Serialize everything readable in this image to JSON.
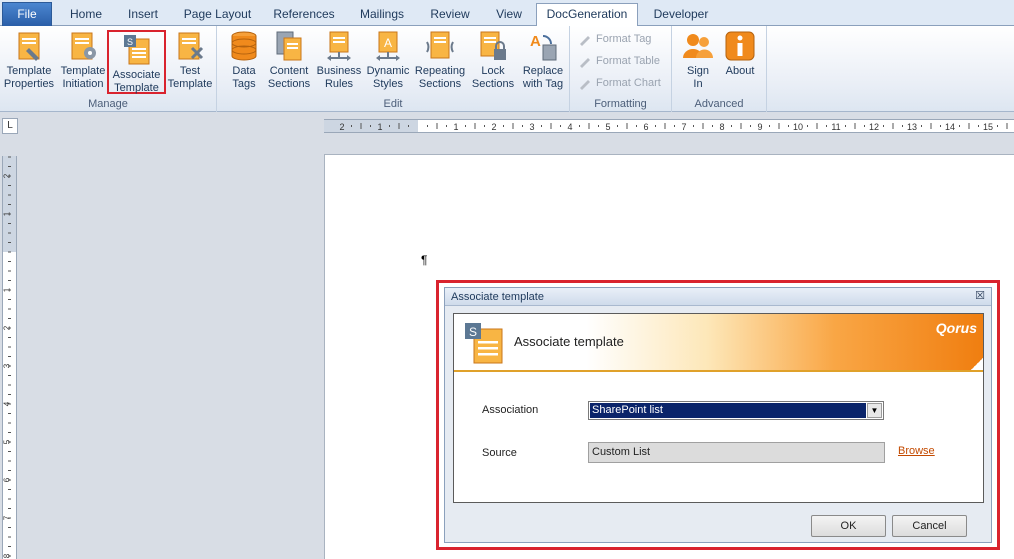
{
  "tabs": [
    {
      "label": "File",
      "name": "tab-file"
    },
    {
      "label": "Home",
      "name": "tab-home"
    },
    {
      "label": "Insert",
      "name": "tab-insert"
    },
    {
      "label": "Page Layout",
      "name": "tab-page-layout"
    },
    {
      "label": "References",
      "name": "tab-references"
    },
    {
      "label": "Mailings",
      "name": "tab-mailings"
    },
    {
      "label": "Review",
      "name": "tab-review"
    },
    {
      "label": "View",
      "name": "tab-view"
    },
    {
      "label": "DocGeneration",
      "name": "tab-docgeneration"
    },
    {
      "label": "Developer",
      "name": "tab-developer"
    }
  ],
  "active_tab": "DocGeneration",
  "ribbon": {
    "groups": {
      "manage": "Manage",
      "edit": "Edit",
      "formatting": "Formatting",
      "advanced": "Advanced"
    },
    "buttons": {
      "template_properties": "Template\nProperties",
      "template_initiation": "Template\nInitiation",
      "associate_template": "Associate\nTemplate",
      "test_template": "Test\nTemplate",
      "data_tags": "Data\nTags",
      "content_sections": "Content\nSections",
      "business_rules": "Business\nRules",
      "dynamic_styles": "Dynamic\nStyles",
      "repeating_sections": "Repeating\nSections",
      "lock_sections": "Lock\nSections",
      "replace_with_tag": "Replace\nwith Tag",
      "format_tag": "Format Tag",
      "format_table": "Format Table",
      "format_chart": "Format Chart",
      "sign_in": "Sign\nIn",
      "about": "About"
    }
  },
  "ruler": {
    "corner": "L",
    "h_labels": [
      "2",
      "1",
      "1",
      "2",
      "3",
      "4",
      "5",
      "6",
      "7",
      "8",
      "9",
      "10",
      "11",
      "12",
      "13",
      "14",
      "15"
    ],
    "v_labels": [
      "2",
      "1",
      "1",
      "2",
      "3",
      "4",
      "5",
      "6",
      "7",
      "8"
    ]
  },
  "document": {
    "cursor": "¶"
  },
  "dialog": {
    "title": "Associate template",
    "close": "☒",
    "banner_title": "Associate template",
    "brand": "Qorus",
    "association_label": "Association",
    "association_value": "SharePoint list",
    "source_label": "Source",
    "source_value": "Custom List",
    "browse": "Browse",
    "ok": "OK",
    "cancel": "Cancel"
  },
  "colors": {
    "highlight": "#d9232e",
    "accent_orange": "#f07e10",
    "selection_blue": "#0a246a"
  }
}
